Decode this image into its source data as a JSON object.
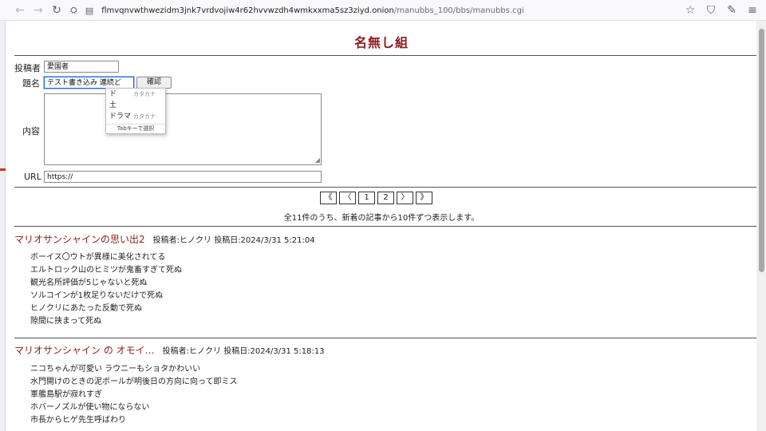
{
  "browser": {
    "url_host": "flmvqnvwthwezidm3jnk7vrdvojiw4r62hvvwzdh4wmkxxma5sz3ziyd.onion",
    "url_path": "/manubbs_100/bbs/manubbs.cgi",
    "back_icon": "←",
    "forward_icon": "→",
    "reload_icon": "↻",
    "bookmark_icon": "☆",
    "shield_icon": "⛉",
    "extensions_icon": "✎",
    "menu_icon": "≡"
  },
  "board": {
    "title": "名無し組"
  },
  "form": {
    "author_label": "投稿者",
    "author_value": "愛国者",
    "subject_label": "題名",
    "subject_value": "テスト書き込み 連続ど",
    "confirm_button": "確認",
    "content_label": "内容",
    "url_label": "URL",
    "url_value": "https://"
  },
  "ime": {
    "candidates": [
      {
        "text": "ド",
        "kana": "カタカナ"
      },
      {
        "text": "土",
        "kana": ""
      },
      {
        "text": "ドラマ",
        "kana": "カタカナ"
      }
    ],
    "hint": "Tabキーで選択"
  },
  "pager": {
    "first": "《",
    "prev": "〈",
    "pages": [
      "1",
      "2"
    ],
    "next": "〉",
    "last": "》",
    "summary": "全11件のうち、新着の記事から10件ずつ表示します。"
  },
  "posts": [
    {
      "title": "マリオサンシャインの思い出2",
      "meta": "投稿者:ヒノクリ 投稿日:2024/3/31 5:21:04",
      "lines": [
        "ボーイス〇ウトが異様に美化されてる",
        "エルトロック山のヒミツが鬼畜すぎて死ぬ",
        "観光名所評価が5じゃないと死ぬ",
        "ソルコインが1枚足りないだけで死ぬ",
        "ヒノクリにあたった反動で死ぬ",
        "隙間に挟まって死ぬ"
      ]
    },
    {
      "title": "マリオサンシャイン の オモイ…",
      "meta": "投稿者:ヒノクリ 投稿日:2024/3/31 5:18:13",
      "lines": [
        "ニコちゃんが可愛い ラウニーもショタかわいい",
        "水門開けのときの泥ボールが明後日の方向に向って即ミス",
        "軍艦島駅が寂れすぎ",
        "ホバーノズルが使い物にならない",
        "市長からヒゲ先生呼ばわり"
      ]
    }
  ]
}
